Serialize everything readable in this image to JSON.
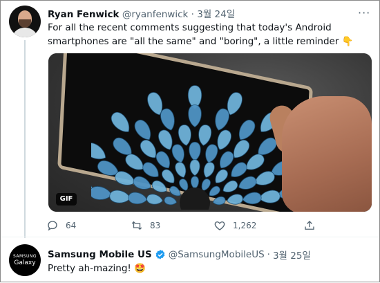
{
  "tweet1": {
    "name": "Ryan Fenwick",
    "handle": "@ryanfenwick",
    "separator": "·",
    "date": "3월 24일",
    "more_icon": "more-dots-icon",
    "text": "For all the recent comments suggesting that today's Android smartphones are \"all the same\" and \"boring\", a little reminder",
    "text_emoji": "👇",
    "media": {
      "badge": "GIF"
    },
    "actions": {
      "reply_count": "64",
      "retweet_count": "83",
      "like_count": "1,262"
    }
  },
  "tweet2": {
    "name": "Samsung Mobile US",
    "handle": "@SamsungMobileUS",
    "separator": "·",
    "date": "3월 25일",
    "avatar_line1": "SAMSUNG",
    "avatar_line2": "Galaxy",
    "text": "Pretty ah-mazing!",
    "text_emoji": "🤩"
  },
  "colors": {
    "text_primary": "#0f1419",
    "text_secondary": "#536471",
    "verified_blue": "#1d9bf0",
    "fan_blue": "#6fb2d9"
  }
}
